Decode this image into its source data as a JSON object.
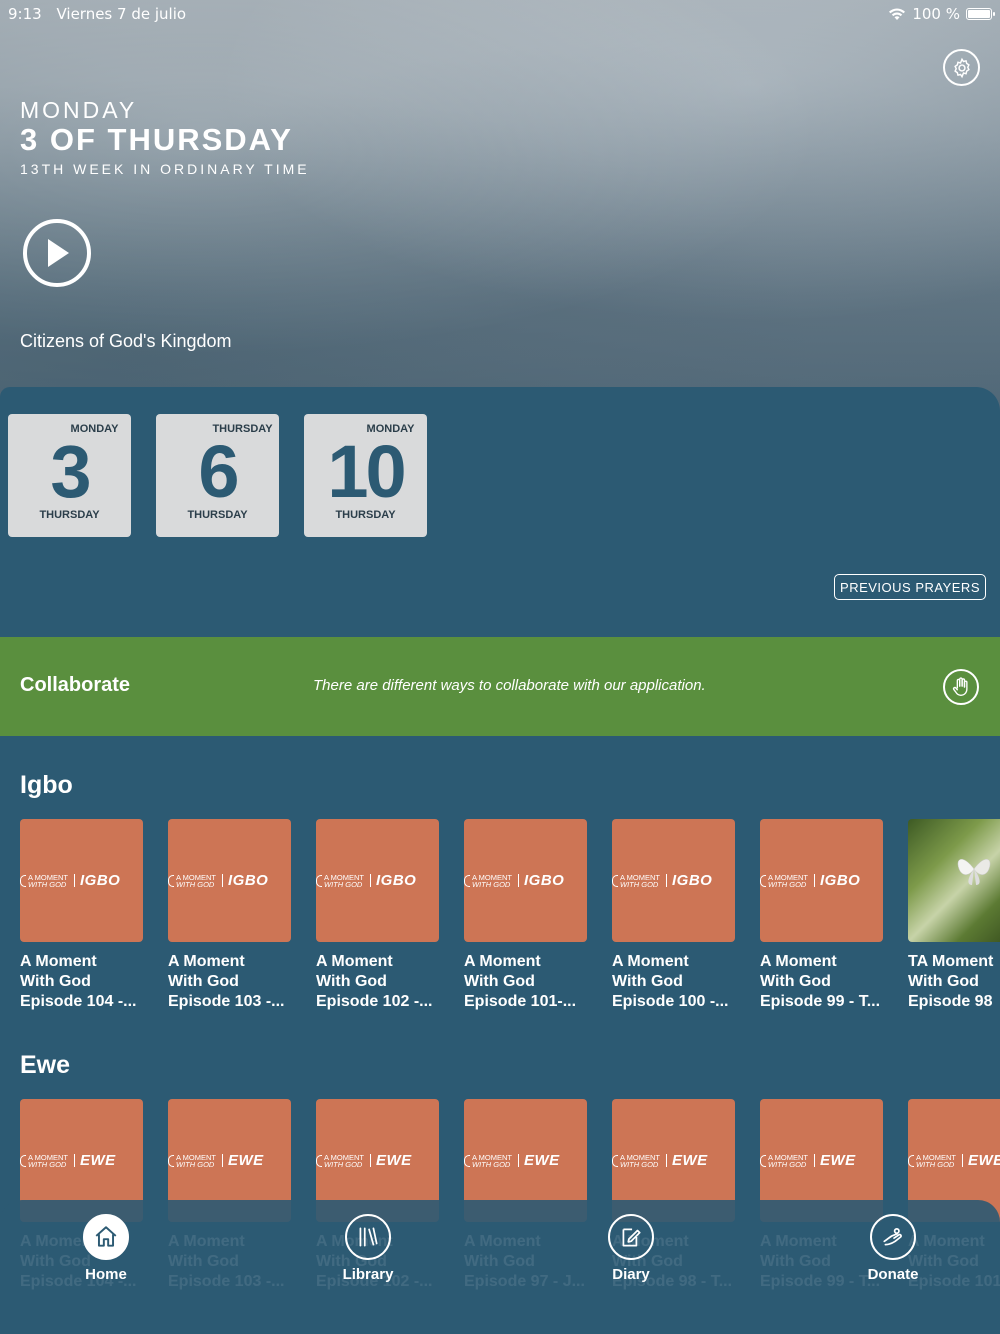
{
  "status": {
    "time": "9:13",
    "date": "Viernes 7 de julio",
    "battery": "100 %"
  },
  "hero": {
    "day": "MONDAY",
    "title": "3 OF THURSDAY",
    "subtitle": "13TH WEEK IN ORDINARY TIME",
    "caption": "Citizens of God's Kingdom"
  },
  "day_cards": [
    {
      "top": "MONDAY",
      "number": "3",
      "bottom": "THURSDAY"
    },
    {
      "top": "THURSDAY",
      "number": "6",
      "bottom": "THURSDAY"
    },
    {
      "top": "MONDAY",
      "number": "10",
      "bottom": "THURSDAY"
    }
  ],
  "previous_prayers_label": "PREVIOUS PRAYERS",
  "collaborate": {
    "title": "Collaborate",
    "text": "There are different ways to collaborate with our application."
  },
  "logo": {
    "line1": "A MOMENT",
    "line2": "WITH GOD"
  },
  "sections": [
    {
      "title": "Igbo",
      "lang": "IGBO",
      "items": [
        {
          "title": [
            "A Moment",
            "With God",
            "Episode 104 -..."
          ]
        },
        {
          "title": [
            "A Moment",
            "With God",
            "Episode 103 -..."
          ]
        },
        {
          "title": [
            "A Moment",
            "With God",
            "Episode 102 -..."
          ]
        },
        {
          "title": [
            "A Moment",
            "With God",
            "Episode 101-..."
          ]
        },
        {
          "title": [
            "A Moment",
            "With God",
            "Episode 100 -..."
          ]
        },
        {
          "title": [
            "A Moment",
            "With God",
            "Episode 99 - T..."
          ]
        },
        {
          "title": [
            "TA Moment",
            "With God",
            "Episode 98"
          ],
          "photo": true
        }
      ]
    },
    {
      "title": "Ewe",
      "lang": "EWE",
      "items": [
        {
          "title": [
            "A Moment",
            "With God",
            "Episode 104 -..."
          ]
        },
        {
          "title": [
            "A Moment",
            "With God",
            "Episode 103 -..."
          ]
        },
        {
          "title": [
            "A Moment",
            "With God",
            "Episode 102 -..."
          ]
        },
        {
          "title": [
            "A Moment",
            "With God",
            "Episode 97 - J..."
          ]
        },
        {
          "title": [
            "A Moment",
            "With God",
            "Episode 98 - T..."
          ]
        },
        {
          "title": [
            "A Moment",
            "With God",
            "Episode 99 - T..."
          ]
        },
        {
          "title": [
            "A Moment",
            "With God",
            "Episode 101"
          ]
        }
      ]
    }
  ],
  "tabs": [
    {
      "label": "Home",
      "icon": "home-icon"
    },
    {
      "label": "Library",
      "icon": "library-icon"
    },
    {
      "label": "Diary",
      "icon": "diary-icon"
    },
    {
      "label": "Donate",
      "icon": "donate-icon"
    }
  ],
  "colors": {
    "background": "#2c5a73",
    "collaborate": "#5a8f3e",
    "thumb": "#cd7555",
    "card": "#d9dadb"
  }
}
